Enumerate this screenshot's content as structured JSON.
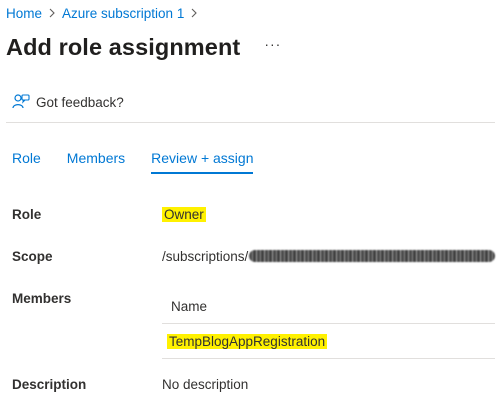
{
  "breadcrumb": {
    "items": [
      "Home",
      "Azure subscription 1"
    ]
  },
  "page": {
    "title": "Add role assignment",
    "more_label": "···"
  },
  "feedback": {
    "label": "Got feedback?"
  },
  "tabs": [
    {
      "label": "Role",
      "active": false
    },
    {
      "label": "Members",
      "active": false
    },
    {
      "label": "Review + assign",
      "active": true
    }
  ],
  "details": {
    "role_label": "Role",
    "role_value": "Owner",
    "scope_label": "Scope",
    "scope_prefix": "/subscriptions/",
    "members_label": "Members",
    "members_table": {
      "header": "Name",
      "rows": [
        "TempBlogAppRegistration"
      ]
    },
    "description_label": "Description",
    "description_value": "No description"
  },
  "colors": {
    "accent": "#0078d4",
    "highlight": "#fff100",
    "text": "#323130"
  }
}
